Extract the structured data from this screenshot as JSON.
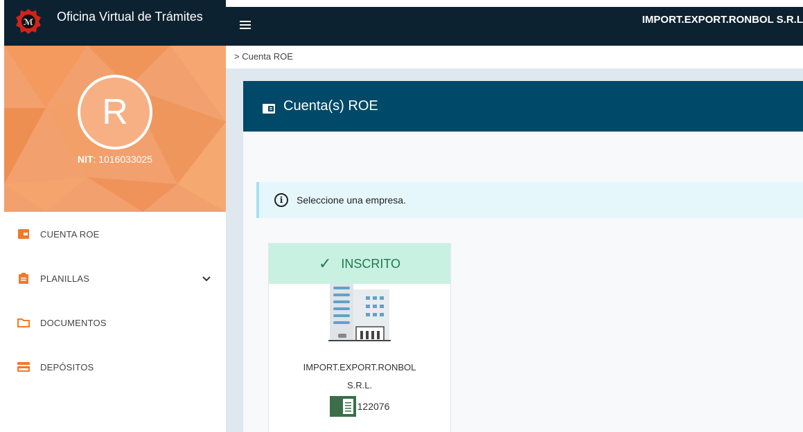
{
  "brand": {
    "title": "Oficina Virtual de Trámites"
  },
  "profile": {
    "avatar_letter": "R",
    "nit_label": "NIT",
    "nit_value": ": 1016033025"
  },
  "menu": [
    {
      "label": "CUENTA ROE",
      "icon": "wallet-icon"
    },
    {
      "label": "PLANILLAS",
      "icon": "clipboard-icon"
    },
    {
      "label": "DOCUMENTOS",
      "icon": "folder-icon"
    },
    {
      "label": "DEPÓSITOS",
      "icon": "credit-card-icon"
    }
  ],
  "topbar": {
    "company": "IMPORT.EXPORT.RONBOL S.R.L"
  },
  "breadcrumb": "> Cuenta ROE",
  "panel": {
    "title": "Cuenta(s) ROE"
  },
  "alert": {
    "text": "Seleccione una empresa."
  },
  "card": {
    "status": "INSCRITO",
    "name_line1": "IMPORT.EXPORT.RONBOL",
    "name_line2": "S.R.L.",
    "roe_number": "122076"
  },
  "colors": {
    "sidebar_accent": "#f28a3c",
    "topbar": "#0d2230",
    "panel_header": "#004968",
    "status_green": "#c8f1e2"
  }
}
